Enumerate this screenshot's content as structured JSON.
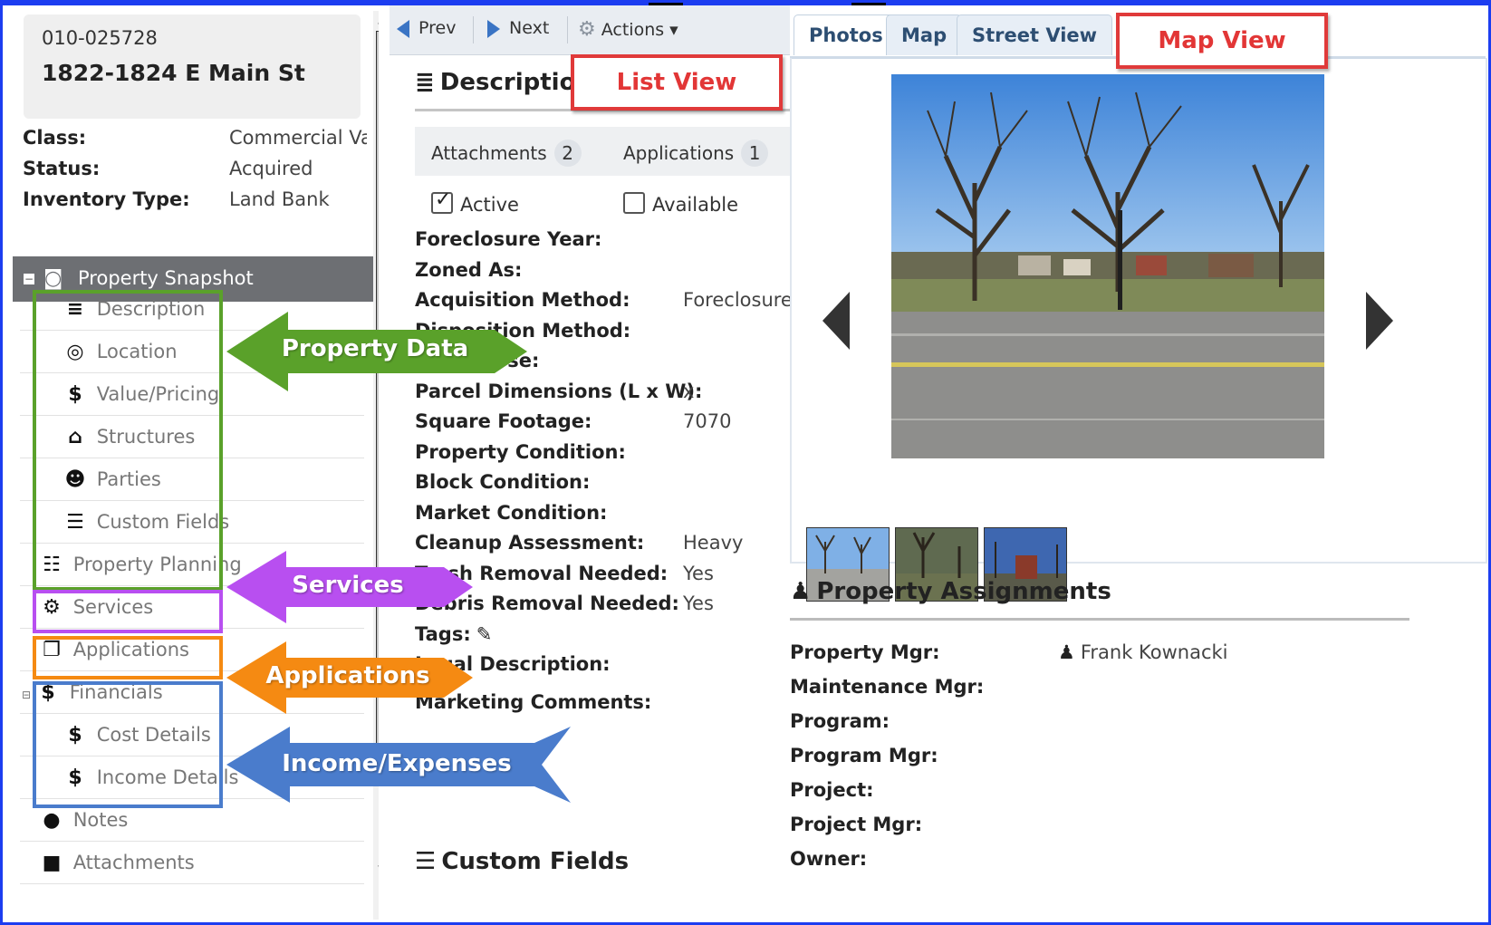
{
  "property": {
    "id": "010-025728",
    "address": "1822-1824 E Main St",
    "class_label": "Class:",
    "class_value": "Commercial Vacant",
    "status_label": "Status:",
    "status_value": "Acquired",
    "inventory_label": "Inventory Type:",
    "inventory_value": "Land Bank"
  },
  "sidebar": {
    "header": "Property Snapshot",
    "items": [
      {
        "label": "Description",
        "icon": "list-icon",
        "glyph": "≡"
      },
      {
        "label": "Location",
        "icon": "compass-icon",
        "glyph": "◎"
      },
      {
        "label": "Value/Pricing",
        "icon": "dollar-icon",
        "glyph": "$"
      },
      {
        "label": "Structures",
        "icon": "home-icon",
        "glyph": "⌂"
      },
      {
        "label": "Parties",
        "icon": "users-icon",
        "glyph": "☻"
      },
      {
        "label": "Custom Fields",
        "icon": "database-icon",
        "glyph": "☰"
      },
      {
        "label": "Property Planning",
        "icon": "planning-icon",
        "glyph": "☷"
      },
      {
        "label": "Services",
        "icon": "cogs-icon",
        "glyph": "⚙"
      },
      {
        "label": "Applications",
        "icon": "documents-icon",
        "glyph": "❐"
      },
      {
        "label": "Financials",
        "icon": "dollar-icon",
        "glyph": "$"
      },
      {
        "label": "Cost Details",
        "icon": "dollar-icon",
        "glyph": "$"
      },
      {
        "label": "Income Details",
        "icon": "dollar-icon",
        "glyph": "$"
      },
      {
        "label": "Notes",
        "icon": "comment-icon",
        "glyph": "●"
      },
      {
        "label": "Attachments",
        "icon": "file-icon",
        "glyph": "■"
      }
    ]
  },
  "toolbar": {
    "prev": "Prev",
    "next": "Next",
    "actions": "Actions ▾"
  },
  "description": {
    "title": "Description",
    "attachments_label": "Attachments",
    "attachments_count": "2",
    "applications_label": "Applications",
    "applications_count": "1",
    "active_label": "Active",
    "active_checked": true,
    "available_label": "Available",
    "available_checked": false,
    "fields": [
      {
        "label": "Foreclosure Year:",
        "value": ""
      },
      {
        "label": "Zoned As:",
        "value": ""
      },
      {
        "label": "Acquisition Method:",
        "value": "Foreclosure"
      },
      {
        "label": "Disposition Method:",
        "value": ""
      },
      {
        "label": "Future Use:",
        "value": ""
      },
      {
        "label": "Parcel Dimensions (L x W):",
        "value": "x"
      },
      {
        "label": "Square Footage:",
        "value": "7070"
      },
      {
        "label": "Property Condition:",
        "value": ""
      },
      {
        "label": "Block Condition:",
        "value": ""
      },
      {
        "label": "Market Condition:",
        "value": ""
      },
      {
        "label": "Cleanup Assessment:",
        "value": "Heavy"
      },
      {
        "label": "Trash Removal Needed:",
        "value": "Yes"
      },
      {
        "label": "Debris Removal Needed:",
        "value": "Yes"
      },
      {
        "label": "Tags:",
        "value": ""
      },
      {
        "label": "Legal Description:",
        "value": ""
      },
      {
        "label": "Marketing Comments:",
        "value": ""
      }
    ],
    "custom_fields_title": "Custom Fields"
  },
  "media": {
    "tabs": [
      "Photos",
      "Map",
      "Street View"
    ]
  },
  "assignments": {
    "title": "Property Assignments",
    "rows": [
      {
        "label": "Property Mgr:",
        "value": "Frank Kownacki"
      },
      {
        "label": "Maintenance Mgr:",
        "value": ""
      },
      {
        "label": "Program:",
        "value": ""
      },
      {
        "label": "Program Mgr:",
        "value": ""
      },
      {
        "label": "Project:",
        "value": ""
      },
      {
        "label": "Project Mgr:",
        "value": ""
      },
      {
        "label": "Owner:",
        "value": ""
      }
    ]
  },
  "annotations": {
    "property_data": "Property Data",
    "services": "Services",
    "applications": "Applications",
    "income_expenses": "Income/Expenses",
    "list_view": "List View",
    "map_view": "Map View"
  },
  "colors": {
    "green": "#5aa12a",
    "purple": "#b84ff0",
    "orange": "#f58a12",
    "blue": "#4a7ccc",
    "red": "#e03a3a",
    "frame": "#1c3df0"
  }
}
